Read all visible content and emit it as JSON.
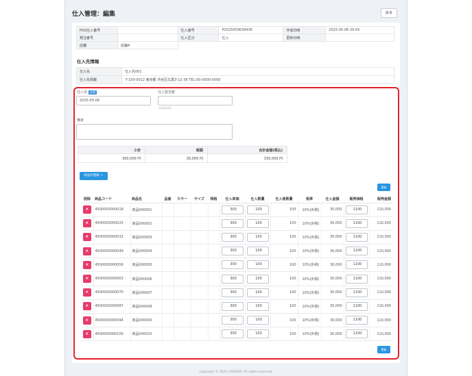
{
  "header": {
    "title": "仕入管理：編集",
    "back_label": "戻る"
  },
  "info": {
    "rows": [
      [
        {
          "k": "POS仕入番号",
          "v": ""
        },
        {
          "k": "仕入番号",
          "v": "P2025050639436"
        },
        {
          "k": "作成日時",
          "v": "2025-05-06 20:43"
        }
      ],
      [
        {
          "k": "発注番号",
          "v": ""
        },
        {
          "k": "仕入区分",
          "v": "仕入"
        },
        {
          "k": "更新日時",
          "v": ""
        }
      ],
      [
        {
          "k": "店舗",
          "v": "店舗A"
        }
      ]
    ]
  },
  "supplier": {
    "section_title": "仕入先情報",
    "name_label": "仕入先",
    "name_value": "仕入先001",
    "detail_label": "仕入先情報",
    "detail_value": "〒150-0012  東京都 渋谷区広尾3-12-36   TEL:00-0000-0000"
  },
  "form": {
    "date_label": "仕入日",
    "required_badge": "必須",
    "date_value": "2025-05-06",
    "staff_label": "仕入担当者",
    "staff_value": "",
    "staff_hint": "20文字以内",
    "note_label": "備考",
    "note_value": ""
  },
  "summary": {
    "headers": [
      "小計",
      "税額",
      "合計金額(税込)"
    ],
    "values": [
      "300,000 円",
      "30,000 円",
      "330,000 円"
    ]
  },
  "buttons": {
    "add_product": "商品の登録 ＋",
    "update": "更新"
  },
  "items": {
    "headers": [
      "削除",
      "商品コード",
      "商品名",
      "品番",
      "カラー",
      "サイズ",
      "規格",
      "仕入単価",
      "仕入数量",
      "仕入後数量",
      "税率",
      "仕入金額",
      "販売価格",
      "販売金額"
    ],
    "rows": [
      {
        "code": "4500000000018",
        "name": "商品000001",
        "unit_price": "300",
        "qty": "100",
        "after_qty": "100",
        "tax": "10%(外税)",
        "amount": "30,000",
        "sell_price": "1100",
        "sell_amount": "110,000"
      },
      {
        "code": "4500000000025",
        "name": "商品000002",
        "unit_price": "300",
        "qty": "100",
        "after_qty": "100",
        "tax": "10%(外税)",
        "amount": "30,000",
        "sell_price": "1100",
        "sell_amount": "110,000"
      },
      {
        "code": "4500000000032",
        "name": "商品000003",
        "unit_price": "300",
        "qty": "100",
        "after_qty": "100",
        "tax": "10%(外税)",
        "amount": "30,000",
        "sell_price": "1100",
        "sell_amount": "110,000"
      },
      {
        "code": "4500000000049",
        "name": "商品000004",
        "unit_price": "300",
        "qty": "100",
        "after_qty": "100",
        "tax": "10%(外税)",
        "amount": "30,000",
        "sell_price": "1100",
        "sell_amount": "110,000"
      },
      {
        "code": "4500000000056",
        "name": "商品000005",
        "unit_price": "300",
        "qty": "100",
        "after_qty": "100",
        "tax": "10%(外税)",
        "amount": "30,000",
        "sell_price": "1100",
        "sell_amount": "110,000"
      },
      {
        "code": "4500000000063",
        "name": "商品000006",
        "unit_price": "300",
        "qty": "100",
        "after_qty": "100",
        "tax": "10%(外税)",
        "amount": "30,000",
        "sell_price": "1100",
        "sell_amount": "110,000"
      },
      {
        "code": "4500000000070",
        "name": "商品000007",
        "unit_price": "300",
        "qty": "100",
        "after_qty": "100",
        "tax": "10%(外税)",
        "amount": "30,000",
        "sell_price": "1100",
        "sell_amount": "110,000"
      },
      {
        "code": "4500000000087",
        "name": "商品000008",
        "unit_price": "300",
        "qty": "100",
        "after_qty": "100",
        "tax": "10%(外税)",
        "amount": "30,000",
        "sell_price": "1100",
        "sell_amount": "110,000"
      },
      {
        "code": "4500000000094",
        "name": "商品000009",
        "unit_price": "300",
        "qty": "100",
        "after_qty": "100",
        "tax": "10%(外税)",
        "amount": "30,000",
        "sell_price": "1100",
        "sell_amount": "110,000"
      },
      {
        "code": "4500000000100",
        "name": "商品000010",
        "unit_price": "300",
        "qty": "100",
        "after_qty": "100",
        "tax": "10%(外税)",
        "amount": "30,000",
        "sell_price": "1100",
        "sell_amount": "110,000"
      }
    ]
  },
  "footer": {
    "copyright": "Copyright © 2025 CASHIER. All rights reserved."
  },
  "colors": {
    "accent": "#2a95e0",
    "danger": "#e83a6b",
    "highlight": "#e2202c"
  }
}
